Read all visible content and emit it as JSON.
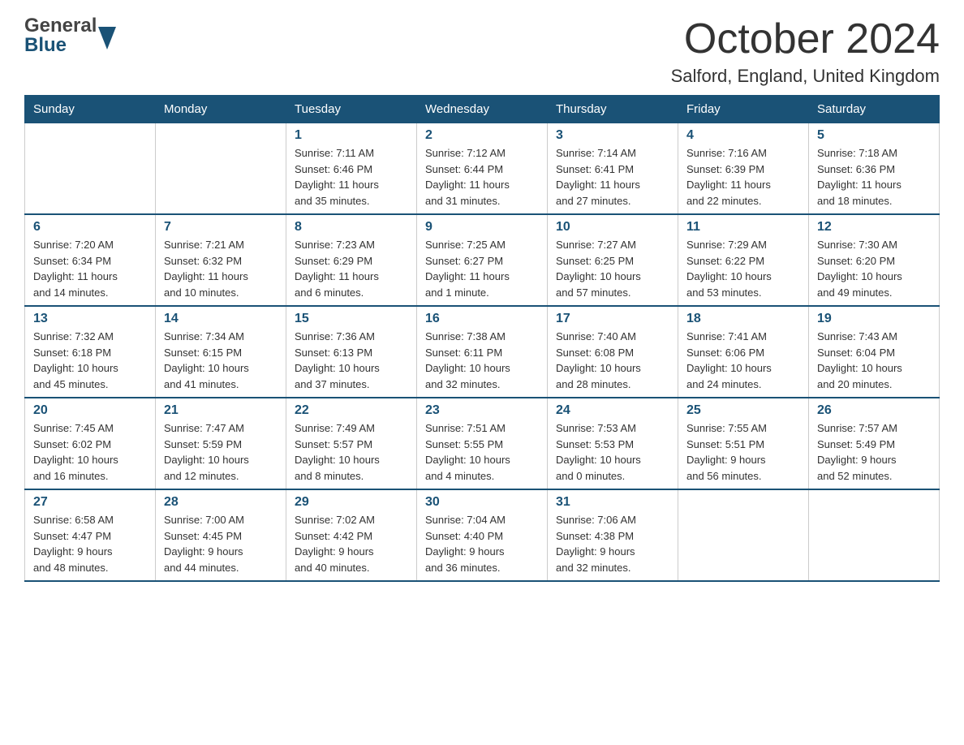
{
  "header": {
    "logo_general": "General",
    "logo_blue": "Blue",
    "title": "October 2024",
    "location": "Salford, England, United Kingdom"
  },
  "days_of_week": [
    "Sunday",
    "Monday",
    "Tuesday",
    "Wednesday",
    "Thursday",
    "Friday",
    "Saturday"
  ],
  "weeks": [
    [
      {
        "day": "",
        "info": ""
      },
      {
        "day": "",
        "info": ""
      },
      {
        "day": "1",
        "info": "Sunrise: 7:11 AM\nSunset: 6:46 PM\nDaylight: 11 hours\nand 35 minutes."
      },
      {
        "day": "2",
        "info": "Sunrise: 7:12 AM\nSunset: 6:44 PM\nDaylight: 11 hours\nand 31 minutes."
      },
      {
        "day": "3",
        "info": "Sunrise: 7:14 AM\nSunset: 6:41 PM\nDaylight: 11 hours\nand 27 minutes."
      },
      {
        "day": "4",
        "info": "Sunrise: 7:16 AM\nSunset: 6:39 PM\nDaylight: 11 hours\nand 22 minutes."
      },
      {
        "day": "5",
        "info": "Sunrise: 7:18 AM\nSunset: 6:36 PM\nDaylight: 11 hours\nand 18 minutes."
      }
    ],
    [
      {
        "day": "6",
        "info": "Sunrise: 7:20 AM\nSunset: 6:34 PM\nDaylight: 11 hours\nand 14 minutes."
      },
      {
        "day": "7",
        "info": "Sunrise: 7:21 AM\nSunset: 6:32 PM\nDaylight: 11 hours\nand 10 minutes."
      },
      {
        "day": "8",
        "info": "Sunrise: 7:23 AM\nSunset: 6:29 PM\nDaylight: 11 hours\nand 6 minutes."
      },
      {
        "day": "9",
        "info": "Sunrise: 7:25 AM\nSunset: 6:27 PM\nDaylight: 11 hours\nand 1 minute."
      },
      {
        "day": "10",
        "info": "Sunrise: 7:27 AM\nSunset: 6:25 PM\nDaylight: 10 hours\nand 57 minutes."
      },
      {
        "day": "11",
        "info": "Sunrise: 7:29 AM\nSunset: 6:22 PM\nDaylight: 10 hours\nand 53 minutes."
      },
      {
        "day": "12",
        "info": "Sunrise: 7:30 AM\nSunset: 6:20 PM\nDaylight: 10 hours\nand 49 minutes."
      }
    ],
    [
      {
        "day": "13",
        "info": "Sunrise: 7:32 AM\nSunset: 6:18 PM\nDaylight: 10 hours\nand 45 minutes."
      },
      {
        "day": "14",
        "info": "Sunrise: 7:34 AM\nSunset: 6:15 PM\nDaylight: 10 hours\nand 41 minutes."
      },
      {
        "day": "15",
        "info": "Sunrise: 7:36 AM\nSunset: 6:13 PM\nDaylight: 10 hours\nand 37 minutes."
      },
      {
        "day": "16",
        "info": "Sunrise: 7:38 AM\nSunset: 6:11 PM\nDaylight: 10 hours\nand 32 minutes."
      },
      {
        "day": "17",
        "info": "Sunrise: 7:40 AM\nSunset: 6:08 PM\nDaylight: 10 hours\nand 28 minutes."
      },
      {
        "day": "18",
        "info": "Sunrise: 7:41 AM\nSunset: 6:06 PM\nDaylight: 10 hours\nand 24 minutes."
      },
      {
        "day": "19",
        "info": "Sunrise: 7:43 AM\nSunset: 6:04 PM\nDaylight: 10 hours\nand 20 minutes."
      }
    ],
    [
      {
        "day": "20",
        "info": "Sunrise: 7:45 AM\nSunset: 6:02 PM\nDaylight: 10 hours\nand 16 minutes."
      },
      {
        "day": "21",
        "info": "Sunrise: 7:47 AM\nSunset: 5:59 PM\nDaylight: 10 hours\nand 12 minutes."
      },
      {
        "day": "22",
        "info": "Sunrise: 7:49 AM\nSunset: 5:57 PM\nDaylight: 10 hours\nand 8 minutes."
      },
      {
        "day": "23",
        "info": "Sunrise: 7:51 AM\nSunset: 5:55 PM\nDaylight: 10 hours\nand 4 minutes."
      },
      {
        "day": "24",
        "info": "Sunrise: 7:53 AM\nSunset: 5:53 PM\nDaylight: 10 hours\nand 0 minutes."
      },
      {
        "day": "25",
        "info": "Sunrise: 7:55 AM\nSunset: 5:51 PM\nDaylight: 9 hours\nand 56 minutes."
      },
      {
        "day": "26",
        "info": "Sunrise: 7:57 AM\nSunset: 5:49 PM\nDaylight: 9 hours\nand 52 minutes."
      }
    ],
    [
      {
        "day": "27",
        "info": "Sunrise: 6:58 AM\nSunset: 4:47 PM\nDaylight: 9 hours\nand 48 minutes."
      },
      {
        "day": "28",
        "info": "Sunrise: 7:00 AM\nSunset: 4:45 PM\nDaylight: 9 hours\nand 44 minutes."
      },
      {
        "day": "29",
        "info": "Sunrise: 7:02 AM\nSunset: 4:42 PM\nDaylight: 9 hours\nand 40 minutes."
      },
      {
        "day": "30",
        "info": "Sunrise: 7:04 AM\nSunset: 4:40 PM\nDaylight: 9 hours\nand 36 minutes."
      },
      {
        "day": "31",
        "info": "Sunrise: 7:06 AM\nSunset: 4:38 PM\nDaylight: 9 hours\nand 32 minutes."
      },
      {
        "day": "",
        "info": ""
      },
      {
        "day": "",
        "info": ""
      }
    ]
  ]
}
